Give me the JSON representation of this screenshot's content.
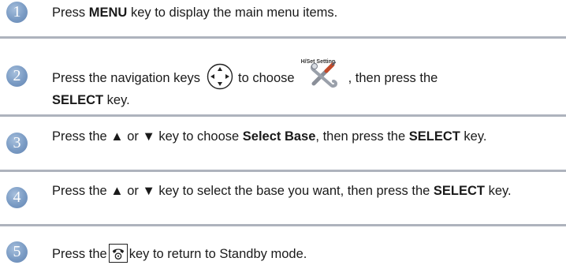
{
  "steps": [
    {
      "number": "1",
      "parts": {
        "a": "Press ",
        "b": "MENU",
        "c": " key to display the main menu items."
      }
    },
    {
      "number": "2",
      "parts": {
        "a": "Press the navigation keys",
        "b": "to choose",
        "c": ", then press the",
        "d": "SELECT",
        "e": " key."
      },
      "icon_label": "H/Set Setting"
    },
    {
      "number": "3",
      "parts": {
        "a": "Press the ▲ or ▼ key to choose ",
        "b": "Select Base",
        "c": ", then press the ",
        "d": "SELECT",
        "e": " key."
      }
    },
    {
      "number": "4",
      "parts": {
        "a": "Press the ▲ or ▼ key to select the base you want, then press the ",
        "b": "SELECT",
        "c": " key."
      }
    },
    {
      "number": "5",
      "parts": {
        "a": "Press the",
        "b": "key to return to Standby mode."
      }
    }
  ],
  "colors": {
    "step_circle": "#7a9bc4",
    "divider": "#aeb3bd",
    "text": "#1a1a1a"
  },
  "icons": {
    "navigation_keys": "navigation-keys-icon",
    "handset_setting": "handset-setting-icon",
    "end_call_key": "end-call-key-icon"
  }
}
